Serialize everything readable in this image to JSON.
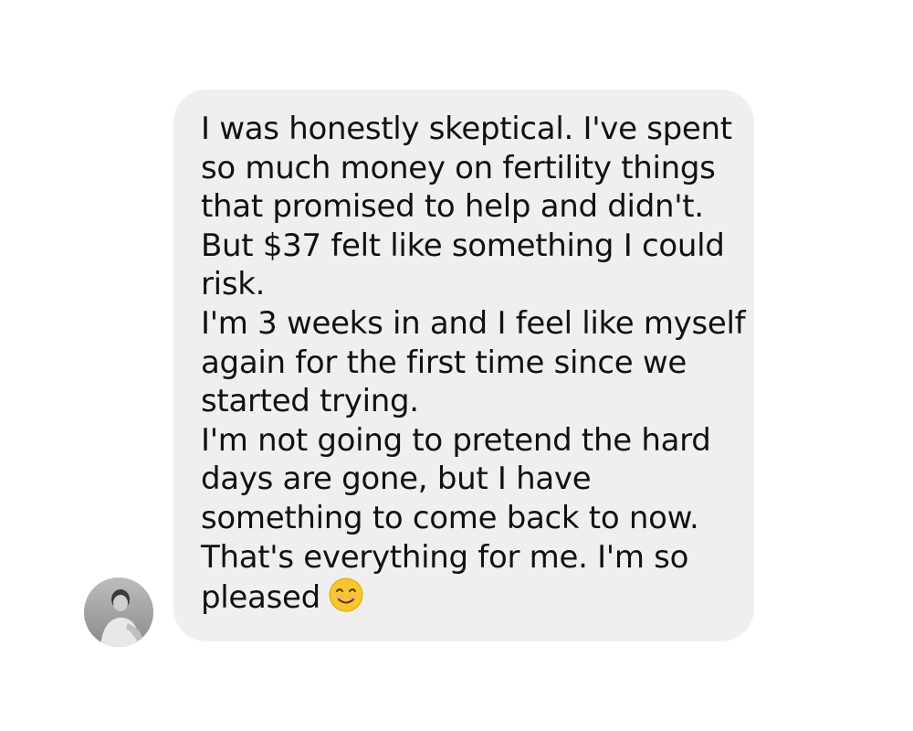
{
  "message": {
    "lines": [
      "I was honestly skeptical. I've spent",
      "so much money on fertility things",
      "that promised to help and didn't.",
      "But $37 felt like something I could",
      "risk.",
      "I'm 3 weeks in and I feel like myself",
      "again for the first time since we",
      "started trying.",
      "I'm not going to pretend the hard",
      "days are gone, but I have",
      "something to come back to now.",
      "That's everything for me. I'm so",
      "pleased"
    ],
    "emoji": "smiling-face-emoji",
    "bubble_color": "#efefef",
    "text_color": "#111111"
  },
  "sender": {
    "avatar_icon": "person-photo-avatar"
  }
}
